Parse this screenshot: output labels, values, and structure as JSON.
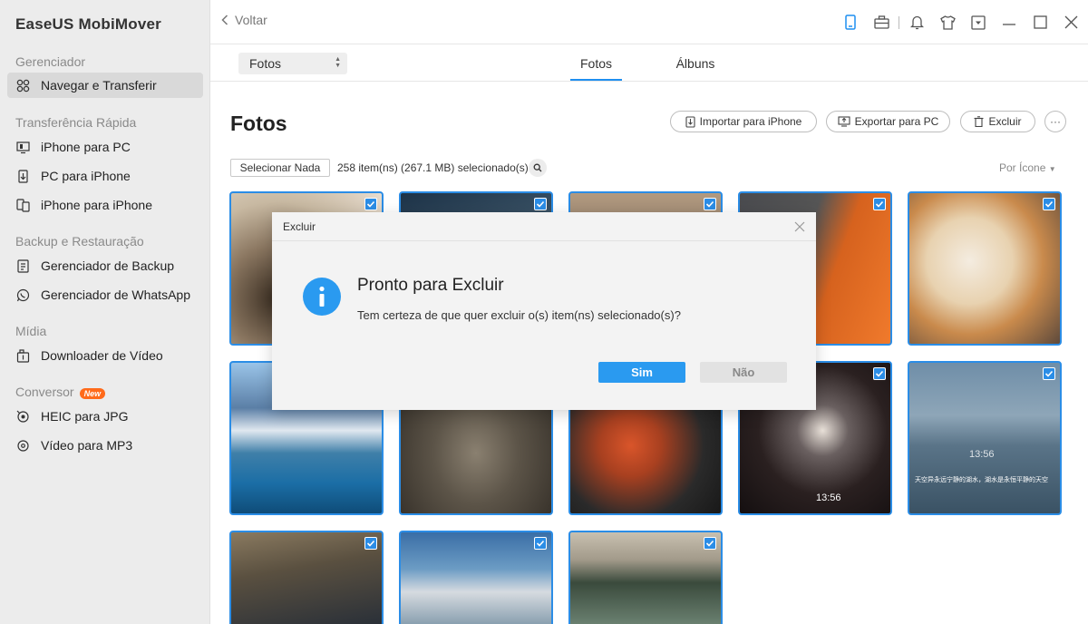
{
  "app": {
    "title": "EaseUS MobiMover"
  },
  "sidebar": {
    "sections": [
      {
        "label": "Gerenciador"
      },
      {
        "label": "Transferência Rápida"
      },
      {
        "label": "Backup e Restauração"
      },
      {
        "label": "Mídia"
      },
      {
        "label": "Conversor",
        "badge": "New"
      }
    ],
    "items": [
      {
        "label": "Navegar e Transferir",
        "icon": "grid-icon",
        "active": true
      },
      {
        "label": "iPhone para PC",
        "icon": "phone-to-pc-icon"
      },
      {
        "label": "PC para iPhone",
        "icon": "pc-to-phone-icon"
      },
      {
        "label": "iPhone para iPhone",
        "icon": "phone-to-phone-icon"
      },
      {
        "label": "Gerenciador de Backup",
        "icon": "backup-icon"
      },
      {
        "label": "Gerenciador de WhatsApp",
        "icon": "whatsapp-icon"
      },
      {
        "label": "Downloader de Vídeo",
        "icon": "download-icon"
      },
      {
        "label": "HEIC para JPG",
        "icon": "image-convert-icon"
      },
      {
        "label": "Vídeo para MP3",
        "icon": "audio-convert-icon"
      }
    ]
  },
  "topbar": {
    "back_label": "Voltar",
    "icons": [
      "phone-icon",
      "toolbox-icon",
      "bell-icon",
      "shirt-icon",
      "dropdown-menu-icon",
      "minimize-icon",
      "maximize-icon",
      "close-icon"
    ]
  },
  "subbar": {
    "select_value": "Fotos",
    "tabs": [
      {
        "label": "Fotos",
        "active": true
      },
      {
        "label": "Álbuns",
        "active": false
      }
    ]
  },
  "content": {
    "title": "Fotos",
    "actions": {
      "import": "Importar para iPhone",
      "export": "Exportar para PC",
      "delete": "Excluir",
      "more": "···"
    },
    "select_none": "Selecionar Nada",
    "selection_info": "258 item(ns) (267.1 MB) selecionado(s)",
    "sort_label": "Por Ícone",
    "photos": [
      {
        "id": 1,
        "checked": true
      },
      {
        "id": 2,
        "checked": true
      },
      {
        "id": 3,
        "checked": true
      },
      {
        "id": 4,
        "checked": true
      },
      {
        "id": 5,
        "checked": true
      },
      {
        "id": 6,
        "checked": true
      },
      {
        "id": 7,
        "checked": true
      },
      {
        "id": 8,
        "checked": true
      },
      {
        "id": 9,
        "checked": true,
        "time": "13:56"
      },
      {
        "id": 10,
        "checked": true,
        "time": "13:56",
        "caption": "天空异永远宁静的湖水，湖水是永恒平静的天空"
      },
      {
        "id": 11,
        "checked": true
      },
      {
        "id": 12,
        "checked": true
      },
      {
        "id": 13,
        "checked": true
      }
    ]
  },
  "modal": {
    "title": "Excluir",
    "heading": "Pronto para Excluir",
    "message": "Tem certeza de que quer excluir o(s) item(ns) selecionado(s)?",
    "yes": "Sim",
    "no": "Não"
  },
  "colors": {
    "accent": "#2a9af0",
    "photo_border": "#2b8de6",
    "badge": "#ff6a1a",
    "sidebar_bg": "#ececec"
  }
}
